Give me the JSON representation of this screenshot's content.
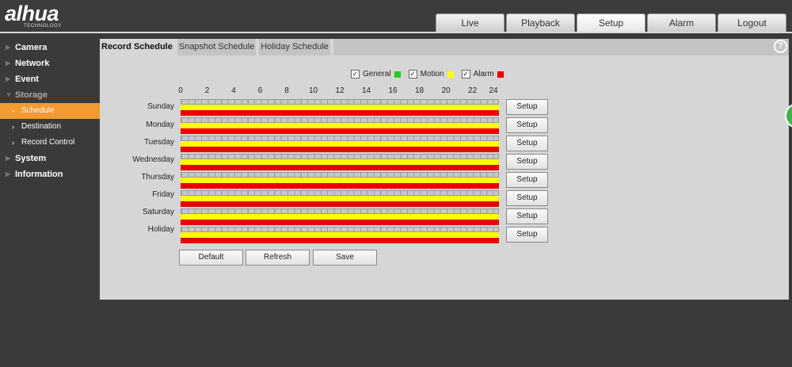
{
  "brand": {
    "logo": "alhua",
    "logo_sub": "TECHNOLOGY"
  },
  "topnav": [
    "Live",
    "Playback",
    "Setup",
    "Alarm",
    "Logout"
  ],
  "topnav_active": "Setup",
  "sidebar": {
    "items": [
      {
        "label": "Camera"
      },
      {
        "label": "Network"
      },
      {
        "label": "Event"
      },
      {
        "label": "Storage"
      },
      {
        "label": "Schedule"
      },
      {
        "label": "Destination"
      },
      {
        "label": "Record Control"
      },
      {
        "label": "System"
      },
      {
        "label": "Information"
      }
    ]
  },
  "subtabs": [
    "Record Schedule",
    "Snapshot Schedule",
    "Holiday Schedule"
  ],
  "legend": [
    {
      "label": "General",
      "checked": true,
      "color": "#22cc22"
    },
    {
      "label": "Motion",
      "checked": true,
      "color": "#ffff00"
    },
    {
      "label": "Alarm",
      "checked": true,
      "color": "#e60000"
    }
  ],
  "hours": [
    "0",
    "2",
    "4",
    "6",
    "8",
    "10",
    "12",
    "14",
    "16",
    "18",
    "20",
    "22",
    "24"
  ],
  "days": [
    "Sunday",
    "Monday",
    "Tuesday",
    "Wednesday",
    "Thursday",
    "Friday",
    "Saturday",
    "Holiday"
  ],
  "setup_label": "Setup",
  "actions": {
    "default": "Default",
    "refresh": "Refresh",
    "save": "Save"
  },
  "help_icon": "?"
}
